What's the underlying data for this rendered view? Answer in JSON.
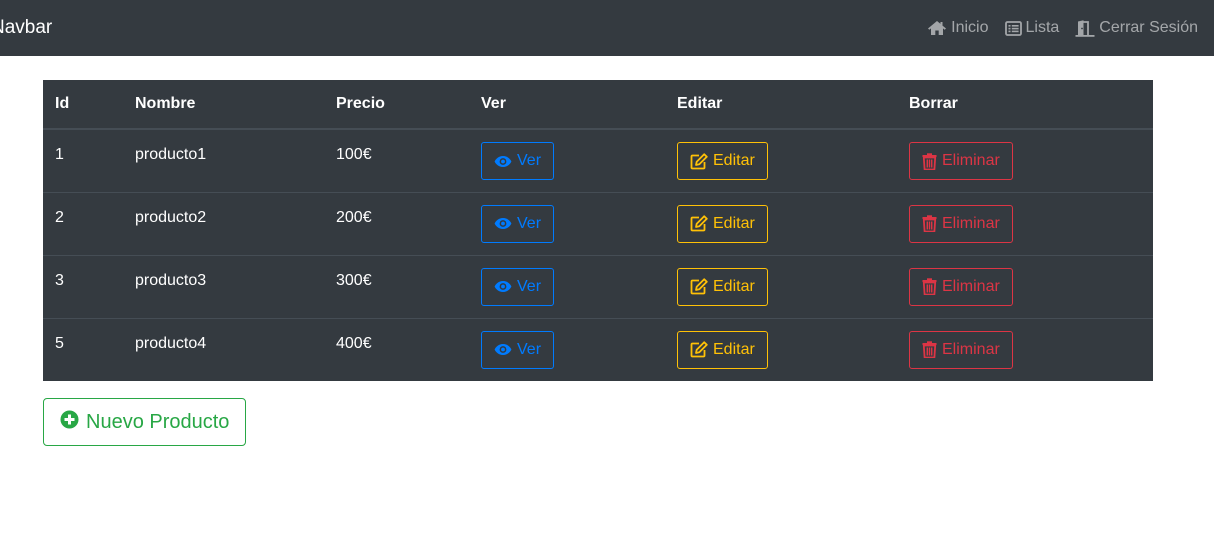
{
  "navbar": {
    "brand": "Navbar",
    "links": [
      {
        "label": "Inicio",
        "icon": "home-icon"
      },
      {
        "label": "Lista",
        "icon": "list-icon"
      },
      {
        "label": "Cerrar Sesión",
        "icon": "door-open-icon"
      }
    ]
  },
  "table": {
    "headers": [
      "Id",
      "Nombre",
      "Precio",
      "Ver",
      "Editar",
      "Borrar"
    ],
    "rows": [
      {
        "id": "1",
        "nombre": "producto1",
        "precio": "100€"
      },
      {
        "id": "2",
        "nombre": "producto2",
        "precio": "200€"
      },
      {
        "id": "3",
        "nombre": "producto3",
        "precio": "300€"
      },
      {
        "id": "5",
        "nombre": "producto4",
        "precio": "400€"
      }
    ],
    "actions": {
      "ver_label": "Ver",
      "editar_label": "Editar",
      "eliminar_label": "Eliminar"
    }
  },
  "new_product_button": {
    "label": "Nuevo Producto",
    "icon": "plus-circle-icon"
  },
  "colors": {
    "navbar_bg": "#343a40",
    "table_bg": "#343a40",
    "ver": "#007bff",
    "editar": "#ffc107",
    "eliminar": "#dc3545",
    "nuevo": "#28a745"
  }
}
